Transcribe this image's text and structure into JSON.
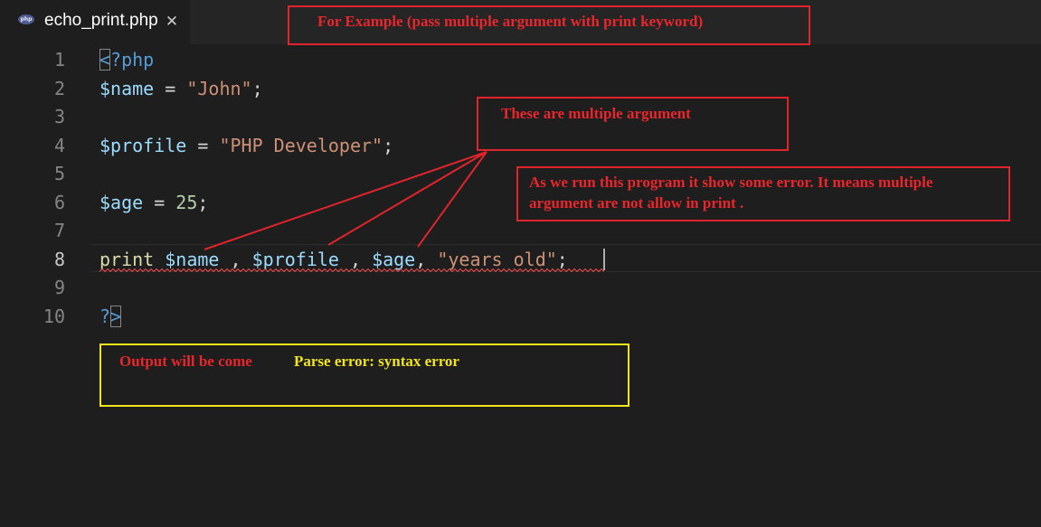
{
  "tab": {
    "icon_label": "php",
    "filename": "echo_print.php",
    "close_glyph": "✕"
  },
  "editor": {
    "lines": [
      {
        "number": "1",
        "tokens": [
          {
            "text": "<",
            "cls": "tk-tag bracket-box"
          },
          {
            "text": "?php",
            "cls": "tk-tag"
          }
        ]
      },
      {
        "number": "2",
        "tokens": [
          {
            "text": "$name",
            "cls": "tk-var"
          },
          {
            "text": " = ",
            "cls": "tk-op"
          },
          {
            "text": "\"John\"",
            "cls": "tk-str"
          },
          {
            "text": ";",
            "cls": "tk-op"
          }
        ]
      },
      {
        "number": "3",
        "tokens": []
      },
      {
        "number": "4",
        "tokens": [
          {
            "text": "$profile",
            "cls": "tk-var"
          },
          {
            "text": " = ",
            "cls": "tk-op"
          },
          {
            "text": "\"PHP Developer\"",
            "cls": "tk-str"
          },
          {
            "text": ";",
            "cls": "tk-op"
          }
        ]
      },
      {
        "number": "5",
        "tokens": []
      },
      {
        "number": "6",
        "tokens": [
          {
            "text": "$age",
            "cls": "tk-var"
          },
          {
            "text": " = ",
            "cls": "tk-op"
          },
          {
            "text": "25",
            "cls": "tk-num"
          },
          {
            "text": ";",
            "cls": "tk-op"
          }
        ]
      },
      {
        "number": "7",
        "tokens": []
      },
      {
        "number": "8",
        "tokens": [
          {
            "text": "print",
            "cls": "tk-kw"
          },
          {
            "text": " ",
            "cls": "tk-op"
          },
          {
            "text": "$name",
            "cls": "tk-var"
          },
          {
            "text": " , ",
            "cls": "tk-op"
          },
          {
            "text": "$profile",
            "cls": "tk-var"
          },
          {
            "text": " , ",
            "cls": "tk-op"
          },
          {
            "text": "$age",
            "cls": "tk-var"
          },
          {
            "text": ", ",
            "cls": "tk-op"
          },
          {
            "text": "\"years old\"",
            "cls": "tk-str"
          },
          {
            "text": ";",
            "cls": "tk-op"
          }
        ]
      },
      {
        "number": "9",
        "tokens": []
      },
      {
        "number": "10",
        "tokens": [
          {
            "text": "?",
            "cls": "tk-tag"
          },
          {
            "text": ">",
            "cls": "tk-tag bracket-box"
          }
        ]
      }
    ],
    "active_line": 8
  },
  "annotations": {
    "example_title": "For Example (pass multiple argument with print keyword)",
    "multiple_args": "These are multiple argument",
    "error_note": "As we run this program it show some error. It means multiple argument are not allow in print .",
    "output_label": "Output will be come",
    "output_value": "Parse error: syntax error"
  },
  "colors": {
    "annotation_red": "#e0242c",
    "annotation_yellow": "#f2e51c",
    "editor_bg": "#1e1e1e",
    "tabbar_bg": "#252526",
    "php_icon_bg": "#4f5b93"
  },
  "icons": {
    "file_icon": "php-file-icon",
    "close_icon": "close-icon"
  }
}
